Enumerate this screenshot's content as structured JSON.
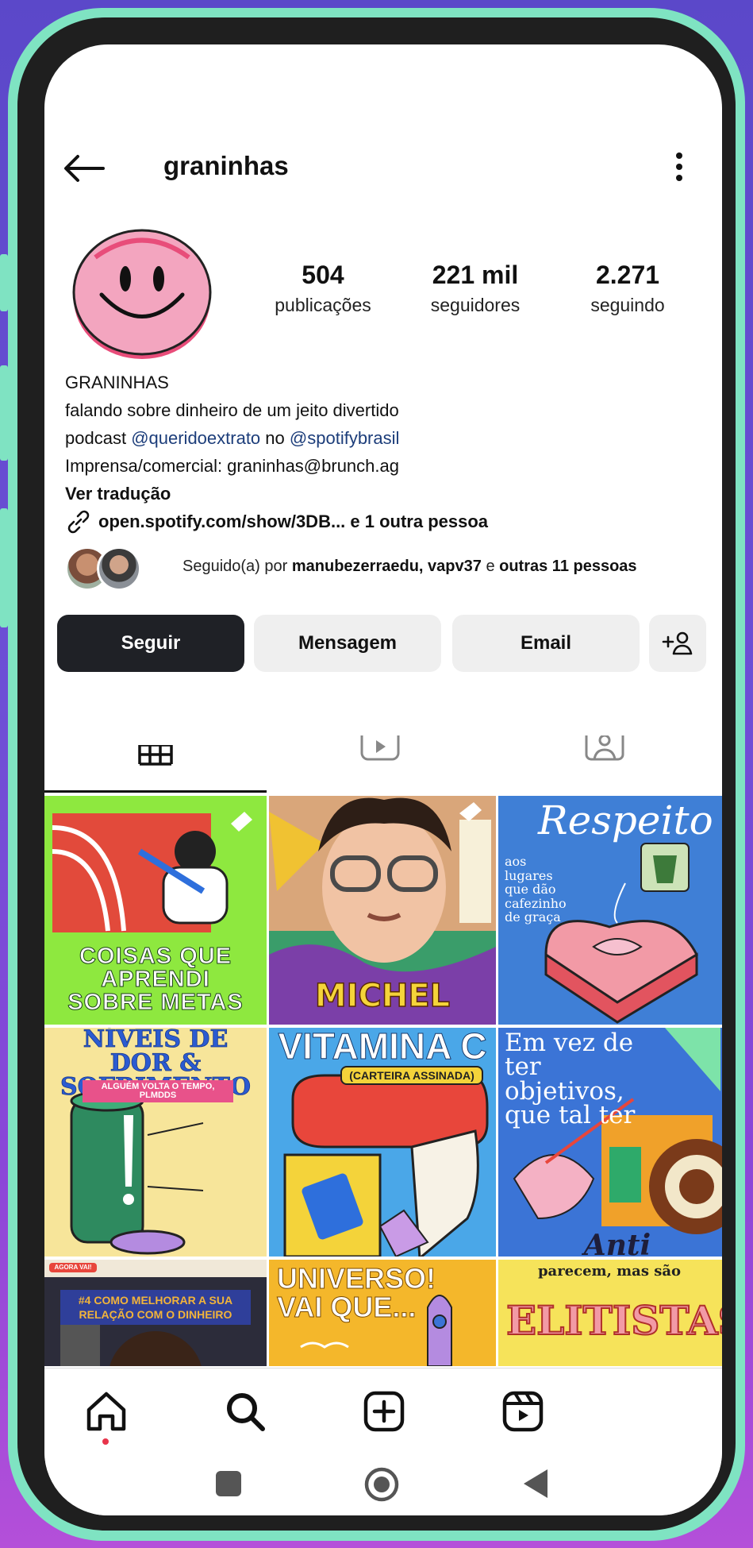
{
  "profile": {
    "username": "graninhas",
    "stats": [
      {
        "value": "504",
        "label": "publicações"
      },
      {
        "value": "221 mil",
        "label": "seguidores"
      },
      {
        "value": "2.271",
        "label": "seguindo"
      }
    ],
    "bio": {
      "name": "GRANINHAS",
      "line1": "falando sobre dinheiro de um jeito divertido",
      "podcast_prefix": "podcast",
      "podcast_mention1": "@queridoextrato",
      "podcast_mid": "no",
      "podcast_mention2": "@spotifybrasil",
      "press": "Imprensa/comercial: graninhas@brunch.ag",
      "translate": "Ver tradução",
      "link": "open.spotify.com/show/3DB... e 1 outra pessoa"
    },
    "followed_by": {
      "prefix": "Seguido(a) por",
      "names": "manubezerraedu, vapv37",
      "mid": "e",
      "others": "outras 11 pessoas"
    },
    "actions": {
      "follow": "Seguir",
      "message": "Mensagem",
      "email": "Email"
    }
  },
  "posts": [
    {
      "title": "COISAS QUE APRENDI SOBRE METAS",
      "bg": "#8ee83f",
      "pinned": true
    },
    {
      "title": "MICHEL",
      "bg": "#e9c29b",
      "pinned": true
    },
    {
      "title": "Respeito",
      "subtitle": "aos lugares que dão cafezinho de graça",
      "bg": "#3f7fd6"
    },
    {
      "title": "NÍVEIS DE DOR & SOFRIMENTO",
      "subtitle": "ALGUÉM VOLTA O TEMPO, PLMDDS",
      "bg": "#f7e59a"
    },
    {
      "title": "VITAMINA C",
      "subtitle": "(CARTEIRA ASSINADA)",
      "bg": "#4aa7e8"
    },
    {
      "title": "Em vez de ter objetivos, que tal ter",
      "subtitle": "Anti OBJETIVOS?",
      "bg": "#3b74d6"
    },
    {
      "title": "#4 COMO MELHORAR A SUA RELAÇÃO COM O DINHEIRO",
      "tag": "AGORA VAI!",
      "bg": "#2c2c3a"
    },
    {
      "title": "UNIVERSO! VAI QUE...",
      "bg": "#f4b72b"
    },
    {
      "title": "ELITISTAS",
      "subtitle": "parecem, mas são",
      "bg": "#f6e35a"
    }
  ],
  "colors": {
    "follow_button": "#1f2126",
    "mention": "#1c3d7a",
    "frame_accent": "#7fe3c2"
  }
}
